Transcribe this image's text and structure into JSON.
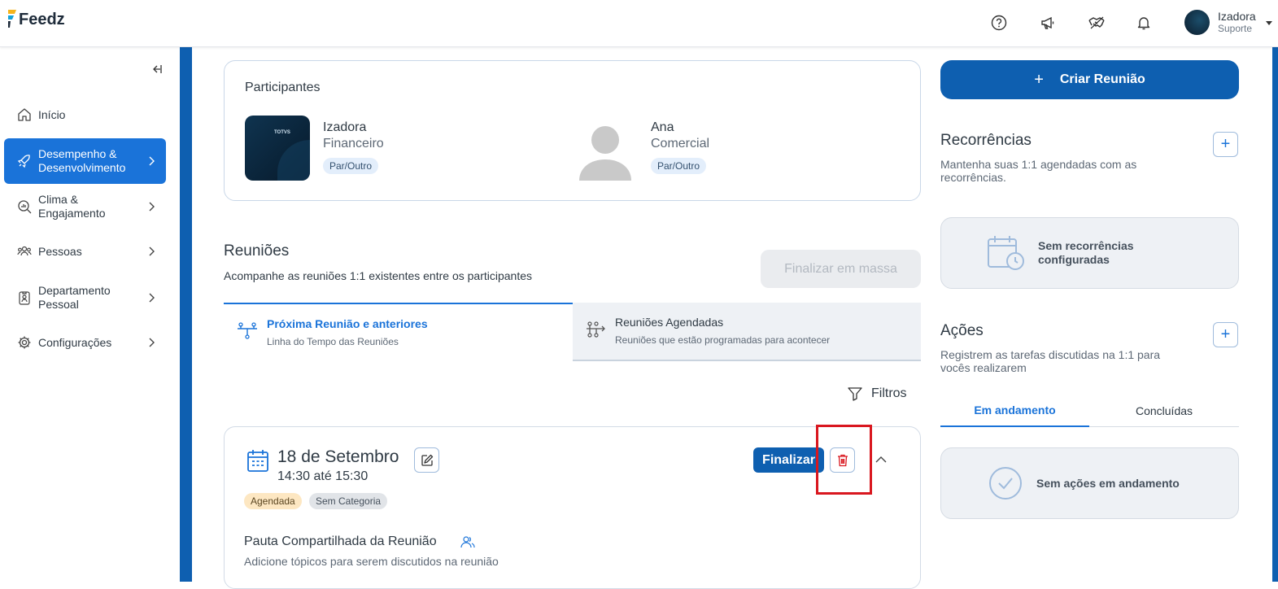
{
  "app": {
    "logo_text": "Feedz"
  },
  "header": {
    "user_name": "Izadora",
    "user_role": "Suporte"
  },
  "sidebar": {
    "items": [
      {
        "label": "Início"
      },
      {
        "label": "Desempenho & Desenvolvimento"
      },
      {
        "label": "Clima & Engajamento"
      },
      {
        "label": "Pessoas"
      },
      {
        "label": "Departamento Pessoal"
      },
      {
        "label": "Configurações"
      }
    ]
  },
  "participants": {
    "title": "Participantes",
    "people": [
      {
        "name": "Izadora",
        "dept": "Financeiro",
        "role": "Par/Outro",
        "avatar_text": "TOTVS"
      },
      {
        "name": "Ana",
        "dept": "Comercial",
        "role": "Par/Outro"
      }
    ]
  },
  "meetings": {
    "title": "Reuniões",
    "subtitle": "Acompanhe as reuniões 1:1 existentes entre os participantes",
    "bulk_finish_label": "Finalizar em massa",
    "tabs": [
      {
        "label": "Próxima Reunião e anteriores",
        "desc": "Linha do Tempo das Reuniões"
      },
      {
        "label": "Reuniões Agendadas",
        "desc": "Reuniões que estão programadas para acontecer"
      }
    ],
    "filters_label": "Filtros",
    "meeting": {
      "date": "18 de Setembro",
      "time": "14:30 até 15:30",
      "finish_label": "Finalizar",
      "tags": [
        "Agendada",
        "Sem Categoria"
      ],
      "agenda_title": "Pauta Compartilhada da Reunião",
      "agenda_desc": "Adicione tópicos para serem discutidos na reunião"
    }
  },
  "right": {
    "create_label": "Criar Reunião",
    "recurrences": {
      "title": "Recorrências",
      "desc": "Mantenha suas 1:1 agendadas com as recorrências.",
      "empty": "Sem recorrências configuradas"
    },
    "actions": {
      "title": "Ações",
      "desc": "Registrem as tarefas discutidas na 1:1 para vocês realizarem",
      "tabs": [
        "Em andamento",
        "Concluídas"
      ],
      "empty": "Sem ações em andamento"
    }
  },
  "colors": {
    "primary": "#0e5fb0",
    "accent": "#1a73d9",
    "highlight": "#d9171f"
  }
}
